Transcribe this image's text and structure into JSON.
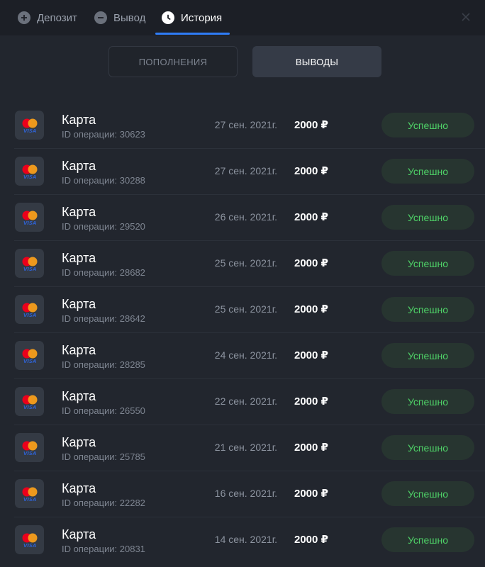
{
  "tabs": {
    "deposit": "Депозит",
    "withdraw": "Вывод",
    "history": "История"
  },
  "segments": {
    "deposits": "ПОПОЛНЕНИЯ",
    "withdrawals": "ВЫВОДЫ"
  },
  "rows": [
    {
      "method": "Карта",
      "op_id": "ID операции: 30623",
      "date": "27 сен. 2021г.",
      "amount": "2000 ₽",
      "status": "Успешно"
    },
    {
      "method": "Карта",
      "op_id": "ID операции: 30288",
      "date": "27 сен. 2021г.",
      "amount": "2000 ₽",
      "status": "Успешно"
    },
    {
      "method": "Карта",
      "op_id": "ID операции: 29520",
      "date": "26 сен. 2021г.",
      "amount": "2000 ₽",
      "status": "Успешно"
    },
    {
      "method": "Карта",
      "op_id": "ID операции: 28682",
      "date": "25 сен. 2021г.",
      "amount": "2000 ₽",
      "status": "Успешно"
    },
    {
      "method": "Карта",
      "op_id": "ID операции: 28642",
      "date": "25 сен. 2021г.",
      "amount": "2000 ₽",
      "status": "Успешно"
    },
    {
      "method": "Карта",
      "op_id": "ID операции: 28285",
      "date": "24 сен. 2021г.",
      "amount": "2000 ₽",
      "status": "Успешно"
    },
    {
      "method": "Карта",
      "op_id": "ID операции: 26550",
      "date": "22 сен. 2021г.",
      "amount": "2000 ₽",
      "status": "Успешно"
    },
    {
      "method": "Карта",
      "op_id": "ID операции: 25785",
      "date": "21 сен. 2021г.",
      "amount": "2000 ₽",
      "status": "Успешно"
    },
    {
      "method": "Карта",
      "op_id": "ID операции: 22282",
      "date": "16 сен. 2021г.",
      "amount": "2000 ₽",
      "status": "Успешно"
    },
    {
      "method": "Карта",
      "op_id": "ID операции: 20831",
      "date": "14 сен. 2021г.",
      "amount": "2000 ₽",
      "status": "Успешно"
    }
  ],
  "icons": {
    "deposit": "plus-circle-icon",
    "withdraw": "minus-circle-icon",
    "history": "clock-icon",
    "close": "close-icon",
    "payment": "mastercard-visa-icon"
  },
  "colors": {
    "accent": "#2f7cf6",
    "success_text": "#4fd368",
    "success_bg": "#273530",
    "background": "#22262e"
  }
}
